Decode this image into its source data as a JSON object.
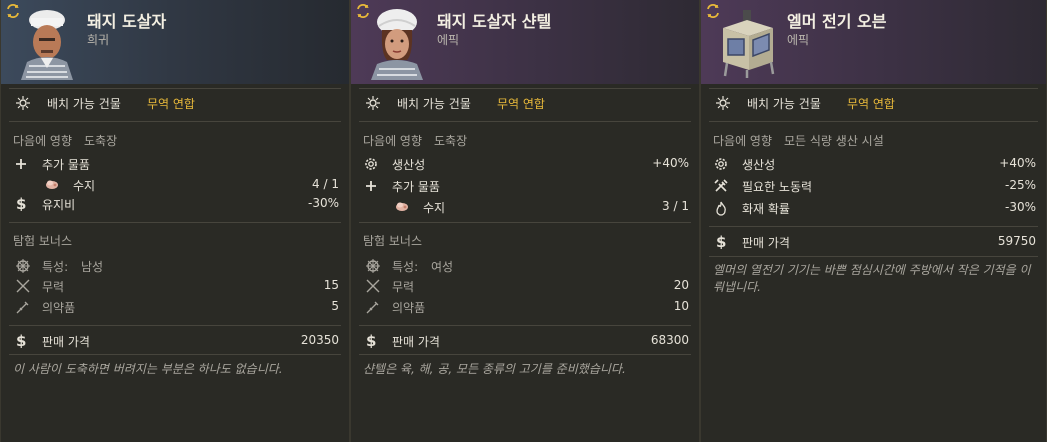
{
  "cards": [
    {
      "title": "돼지 도살자",
      "rarity": "희귀",
      "building_label": "배치 가능 건물",
      "building_value": "무역 연합",
      "influence_label": "다음에 영향",
      "influence_target": "도축장",
      "stats": [
        {
          "icon": "plus-icon",
          "label": "추가 물품",
          "value": ""
        },
        {
          "icon": "tallow-icon",
          "label": "수지",
          "value": "4 / 1"
        },
        {
          "icon": "dollar-icon",
          "label": "유지비",
          "value": "-30%"
        }
      ],
      "expedition_label": "탐험 보너스",
      "expedition": [
        {
          "icon": "wheel-icon",
          "label": "특성:",
          "extra": "남성",
          "value": ""
        },
        {
          "icon": "swords-icon",
          "label": "무력",
          "value": "15"
        },
        {
          "icon": "syringe-icon",
          "label": "의약품",
          "value": "5"
        }
      ],
      "price_label": "판매 가격",
      "price": "20350",
      "description": "이 사람이 도축하면 버려지는 부분은 하나도 없습니다."
    },
    {
      "title": "돼지 도살자 샨텔",
      "rarity": "에픽",
      "building_label": "배치 가능 건물",
      "building_value": "무역 연합",
      "influence_label": "다음에 영향",
      "influence_target": "도축장",
      "stats": [
        {
          "icon": "gear-icon",
          "label": "생산성",
          "value": "+40%"
        },
        {
          "icon": "plus-icon",
          "label": "추가 물품",
          "value": ""
        },
        {
          "icon": "tallow-icon",
          "label": "수지",
          "value": "3 / 1"
        }
      ],
      "expedition_label": "탐험 보너스",
      "expedition": [
        {
          "icon": "wheel-icon",
          "label": "특성:",
          "extra": "여성",
          "value": ""
        },
        {
          "icon": "swords-icon",
          "label": "무력",
          "value": "20"
        },
        {
          "icon": "syringe-icon",
          "label": "의약품",
          "value": "10"
        }
      ],
      "price_label": "판매 가격",
      "price": "68300",
      "description": "샨텔은 육, 해, 공, 모든 종류의 고기를 준비했습니다."
    },
    {
      "title": "엘머 전기 오븐",
      "rarity": "에픽",
      "building_label": "배치 가능 건물",
      "building_value": "무역 연합",
      "influence_label": "다음에 영향",
      "influence_target": "모든 식량 생산 시설",
      "stats": [
        {
          "icon": "gear-icon",
          "label": "생산성",
          "value": "+40%"
        },
        {
          "icon": "hammer-icon",
          "label": "필요한 노동력",
          "value": "-25%"
        },
        {
          "icon": "fire-icon",
          "label": "화재 확률",
          "value": "-30%"
        }
      ],
      "price_label": "판매 가격",
      "price": "59750",
      "description": "엘머의 열전기 기기는 바쁜 점심시간에 주방에서 작은 기적을 이뤄냅니다."
    }
  ],
  "colors": {
    "gold": "#e8b93a",
    "text": "#e6e2d8",
    "muted": "#a9a69e",
    "rare_header": "#3c4a5c",
    "epic_header": "#4e3a57"
  }
}
